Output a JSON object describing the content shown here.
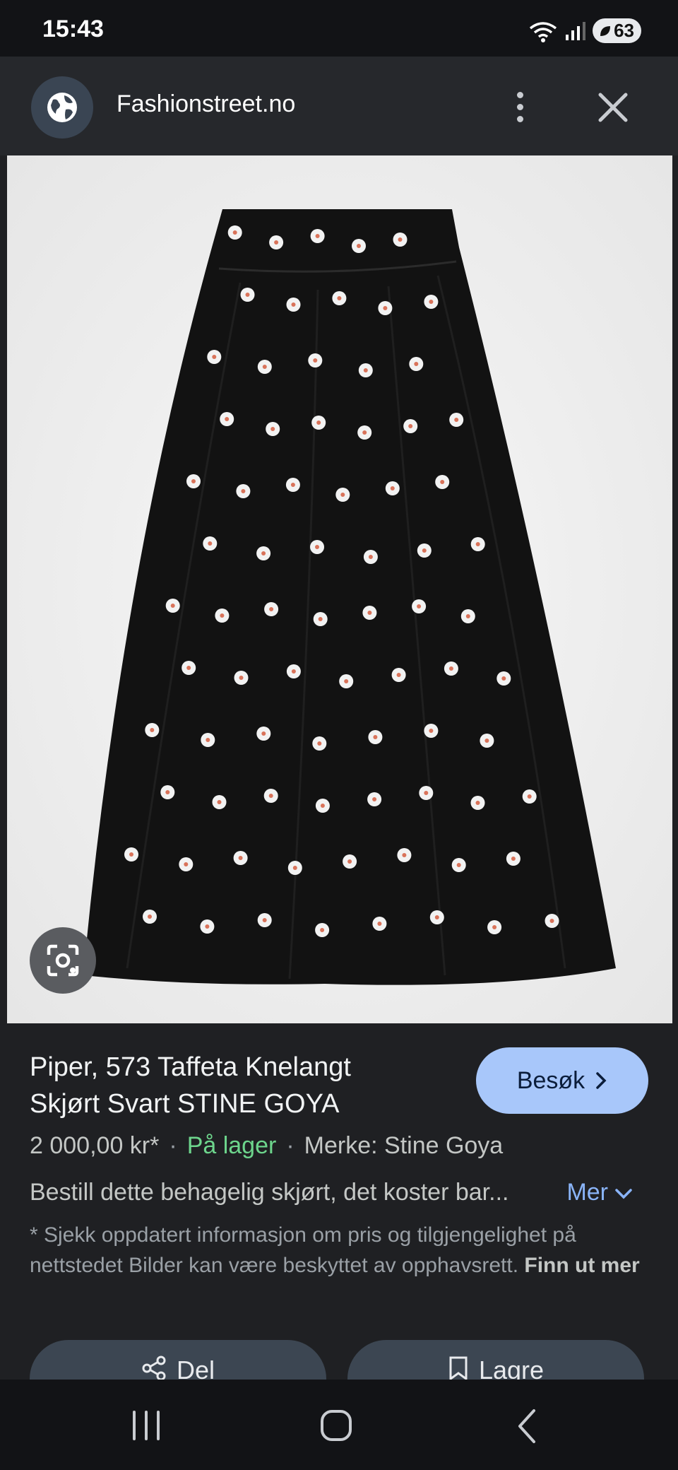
{
  "status_bar": {
    "time": "15:43",
    "battery": "63"
  },
  "top_bar": {
    "site_name": "Fashionstreet.no"
  },
  "product": {
    "title_line1": "Piper, 573 Taffeta Knelangt",
    "title_line2": "Skjørt Svart STINE GOYA",
    "visit_label": "Besøk",
    "price": "2 000,00 kr*",
    "stock": "På lager",
    "brand": "Merke: Stine Goya",
    "description": "Bestill dette behagelig skjørt, det koster bar...",
    "more_label": "Mer",
    "disclaimer": "* Sjekk oppdatert informasjon om pris og tilgjengelighet på nettstedet Bilder kan være beskyttet av opphavsrett.",
    "learn_more": "Finn ut mer"
  },
  "actions": {
    "share_label": "Del",
    "save_label": "Lagre"
  },
  "colors": {
    "accent_button": "#a8c7fa",
    "in_stock": "#6dd58c",
    "link": "#8ab4f8"
  },
  "icons": [
    "globe-icon",
    "more-vert-icon",
    "close-icon",
    "lens-icon",
    "chevron-right-icon",
    "chevron-down-icon",
    "share-icon",
    "bookmark-icon",
    "recents-icon",
    "home-icon",
    "back-icon"
  ]
}
